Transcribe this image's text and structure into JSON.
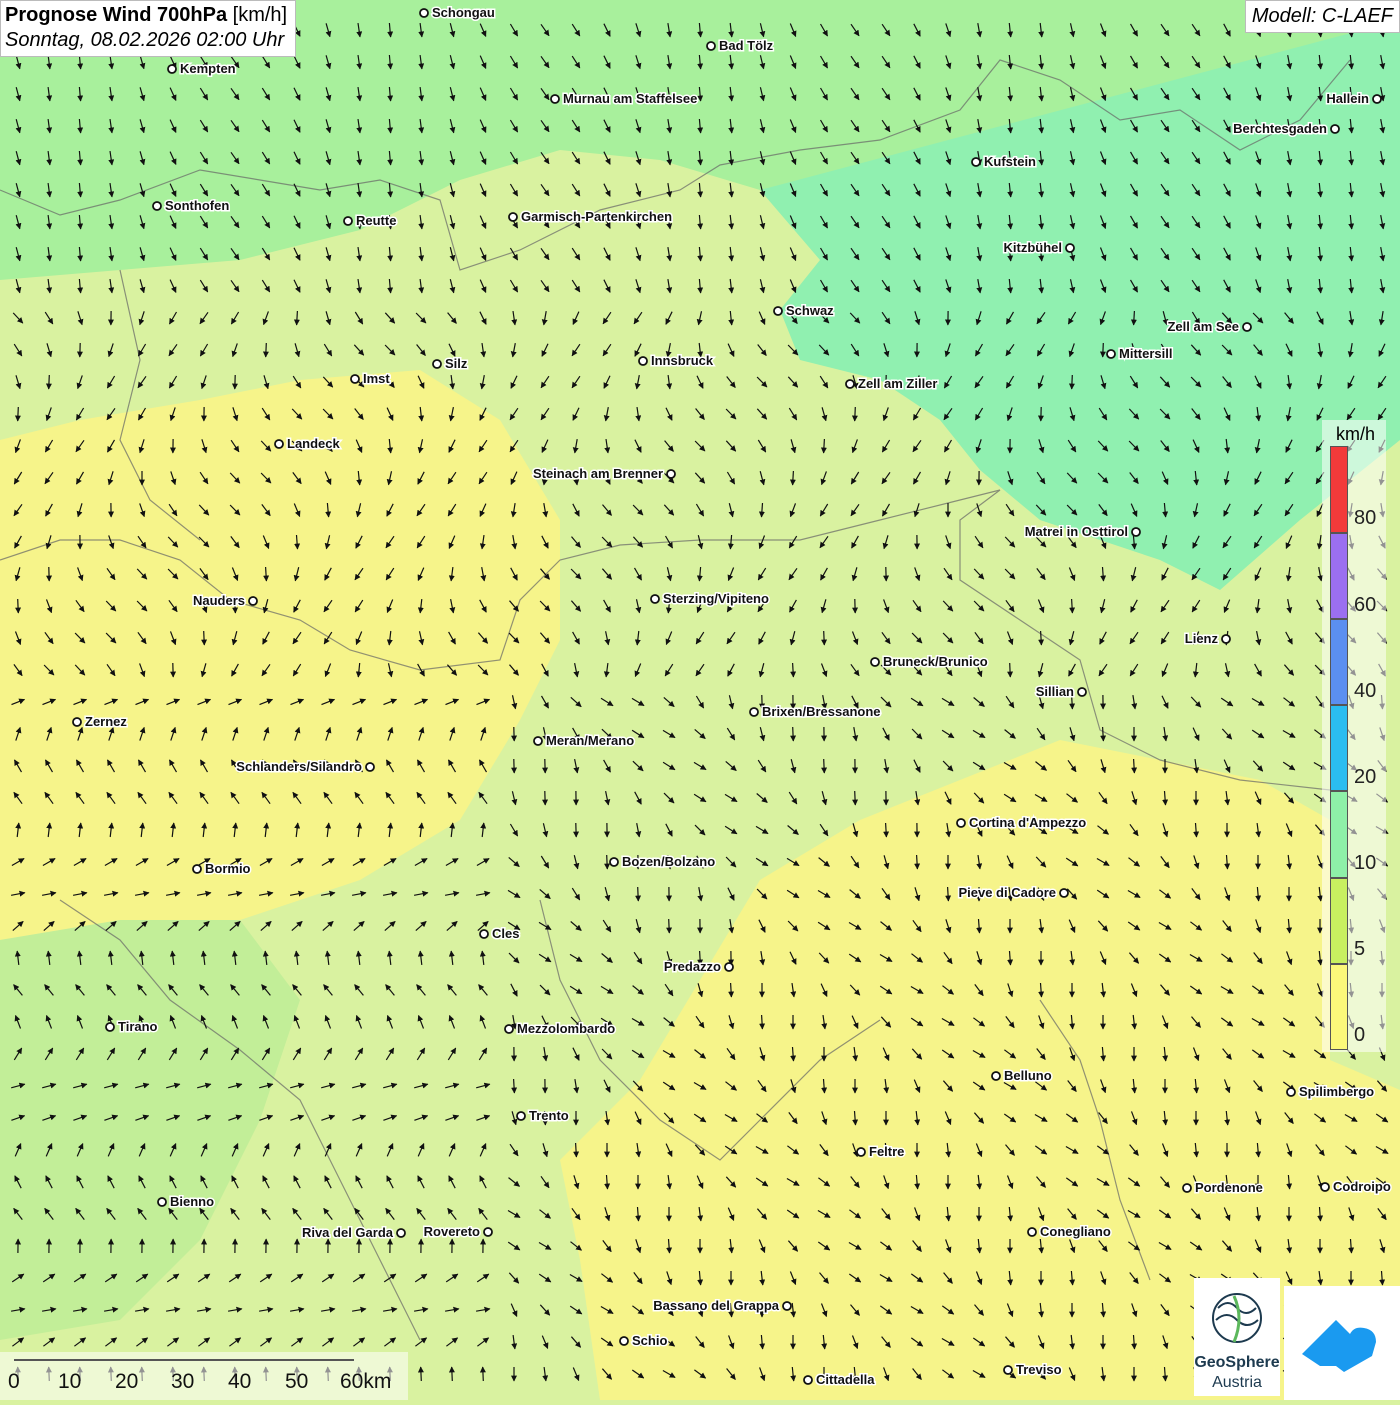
{
  "title": {
    "main": "Prognose Wind 700hPa",
    "unit": "[km/h]",
    "datetime": "Sonntag, 08.02.2026 02:00 Uhr"
  },
  "model": "Modell: C-LAEF",
  "legend": {
    "unit": "km/h",
    "labels": [
      "80",
      "60",
      "40",
      "20",
      "10",
      "5",
      "0"
    ],
    "colors": [
      "#f23a3a",
      "#9b6ff0",
      "#5b8ff0",
      "#2bbdf0",
      "#8ef0a8",
      "#c8f060",
      "#fbf87a"
    ]
  },
  "scale": {
    "labels": [
      "0",
      "10",
      "20",
      "30",
      "40",
      "50",
      "60km"
    ]
  },
  "cities": [
    {
      "name": "Schongau"
    },
    {
      "name": "Bad Tölz"
    },
    {
      "name": "Kempten"
    },
    {
      "name": "Murnau am Staffelsee"
    },
    {
      "name": "Hallein"
    },
    {
      "name": "Berchtesgaden"
    },
    {
      "name": "Kufstein"
    },
    {
      "name": "Sonthofen"
    },
    {
      "name": "Reutte"
    },
    {
      "name": "Garmisch-Partenkirchen"
    },
    {
      "name": "Kitzbühel"
    },
    {
      "name": "Schwaz"
    },
    {
      "name": "Zell am See"
    },
    {
      "name": "Mittersill"
    },
    {
      "name": "Silz"
    },
    {
      "name": "Innsbruck"
    },
    {
      "name": "Imst"
    },
    {
      "name": "Zell am Ziller"
    },
    {
      "name": "Landeck"
    },
    {
      "name": "Steinach am Brenner"
    },
    {
      "name": "Matrei in Osttirol"
    },
    {
      "name": "Nauders"
    },
    {
      "name": "Sterzing/Vipiteno"
    },
    {
      "name": "Lienz"
    },
    {
      "name": "Bruneck/Brunico"
    },
    {
      "name": "Sillian"
    },
    {
      "name": "Zernez"
    },
    {
      "name": "Brixen/Bressanone"
    },
    {
      "name": "Meran/Merano"
    },
    {
      "name": "Schlanders/Silandro"
    },
    {
      "name": "Cortina d'Ampezzo"
    },
    {
      "name": "Bozen/Bolzano"
    },
    {
      "name": "Bormio"
    },
    {
      "name": "Pieve di Cadore"
    },
    {
      "name": "Cles"
    },
    {
      "name": "Predazzo"
    },
    {
      "name": "Tirano"
    },
    {
      "name": "Mezzolombardo"
    },
    {
      "name": "Belluno"
    },
    {
      "name": "Spilimbergo"
    },
    {
      "name": "Trento"
    },
    {
      "name": "Feltre"
    },
    {
      "name": "Pordenone"
    },
    {
      "name": "Codroipo"
    },
    {
      "name": "Bienno"
    },
    {
      "name": "Riva del Garda"
    },
    {
      "name": "Rovereto"
    },
    {
      "name": "Conegliano"
    },
    {
      "name": "Bassano del Grappa"
    },
    {
      "name": "Schio"
    },
    {
      "name": "Treviso"
    },
    {
      "name": "Cittadella"
    }
  ],
  "logo": {
    "line1": "GeoSphere",
    "line2": "Austria"
  }
}
